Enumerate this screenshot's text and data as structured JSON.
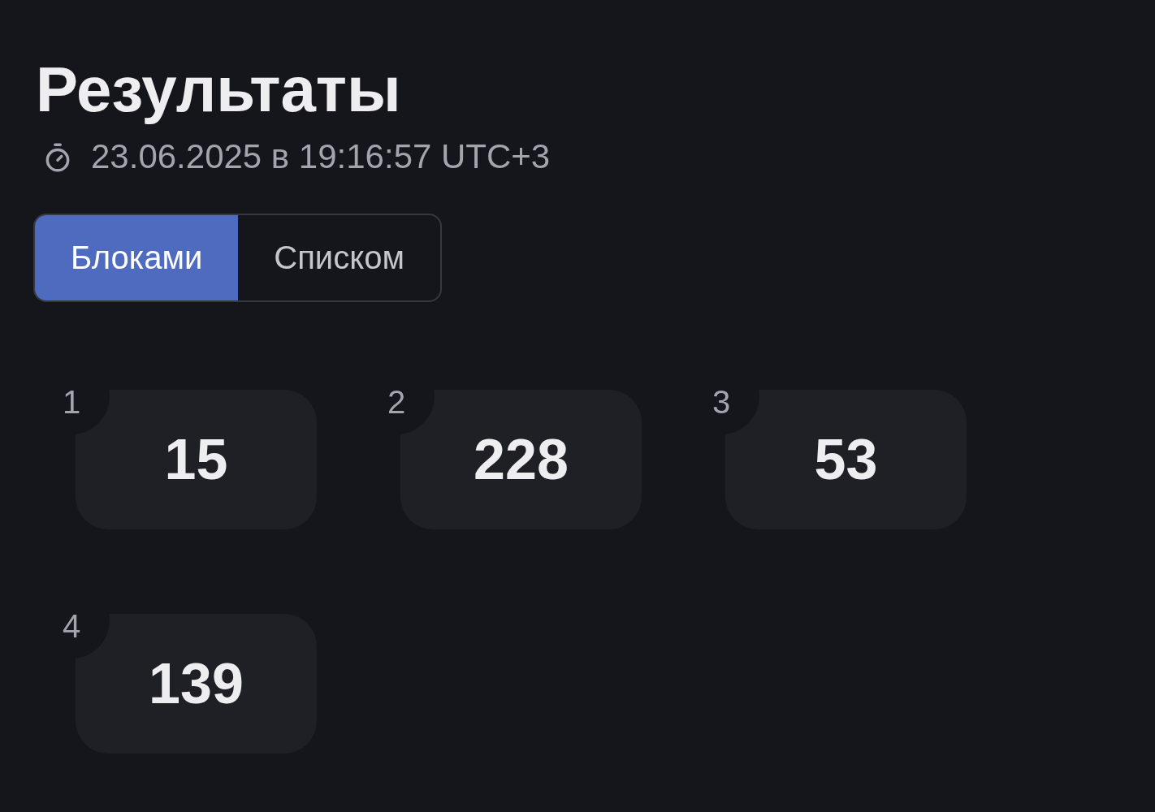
{
  "title": "Результаты",
  "timestamp": "23.06.2025 в 19:16:57 UTC+3",
  "view_tabs": [
    {
      "label": "Блоками",
      "selected": true
    },
    {
      "label": "Списком",
      "selected": false
    }
  ],
  "results": [
    {
      "index": "1",
      "value": "15"
    },
    {
      "index": "2",
      "value": "228"
    },
    {
      "index": "3",
      "value": "53"
    },
    {
      "index": "4",
      "value": "139"
    }
  ]
}
